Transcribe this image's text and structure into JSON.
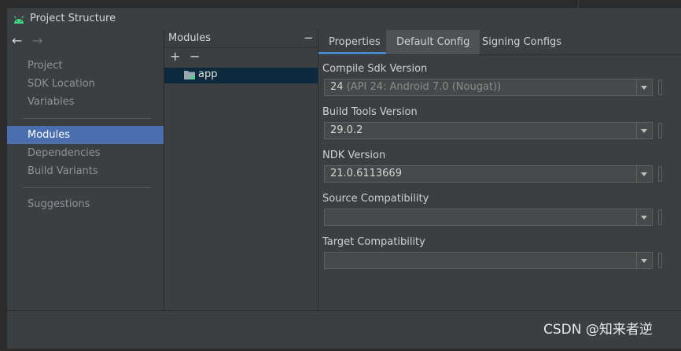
{
  "window": {
    "title": "Project Structure"
  },
  "nav": {
    "back": "←",
    "forward": "→",
    "items": [
      {
        "label": "Project"
      },
      {
        "label": "SDK Location"
      },
      {
        "label": "Variables"
      },
      {
        "label": "Modules"
      },
      {
        "label": "Dependencies"
      },
      {
        "label": "Build Variants"
      },
      {
        "label": "Suggestions"
      }
    ],
    "selected": "Modules"
  },
  "modules": {
    "title": "Modules",
    "collapse": "−",
    "add": "+",
    "remove": "−",
    "items": [
      {
        "label": "app"
      }
    ]
  },
  "tabs": [
    {
      "label": "Properties"
    },
    {
      "label": "Default Config"
    },
    {
      "label": "Signing Configs"
    }
  ],
  "fields": {
    "compile_sdk": {
      "label": "Compile Sdk Version",
      "value": "24",
      "hint": "(API 24: Android 7.0 (Nougat))"
    },
    "build_tools": {
      "label": "Build Tools Version",
      "value": "29.0.2"
    },
    "ndk": {
      "label": "NDK Version",
      "value": "21.0.6113669"
    },
    "source_compat": {
      "label": "Source Compatibility",
      "value": ""
    },
    "target_compat": {
      "label": "Target Compatibility",
      "value": ""
    }
  },
  "watermark": "CSDN @知来者逆",
  "colors": {
    "selection": "#4b6eaf",
    "tab_underline": "#4a88c7",
    "android_green": "#3ddc84"
  }
}
